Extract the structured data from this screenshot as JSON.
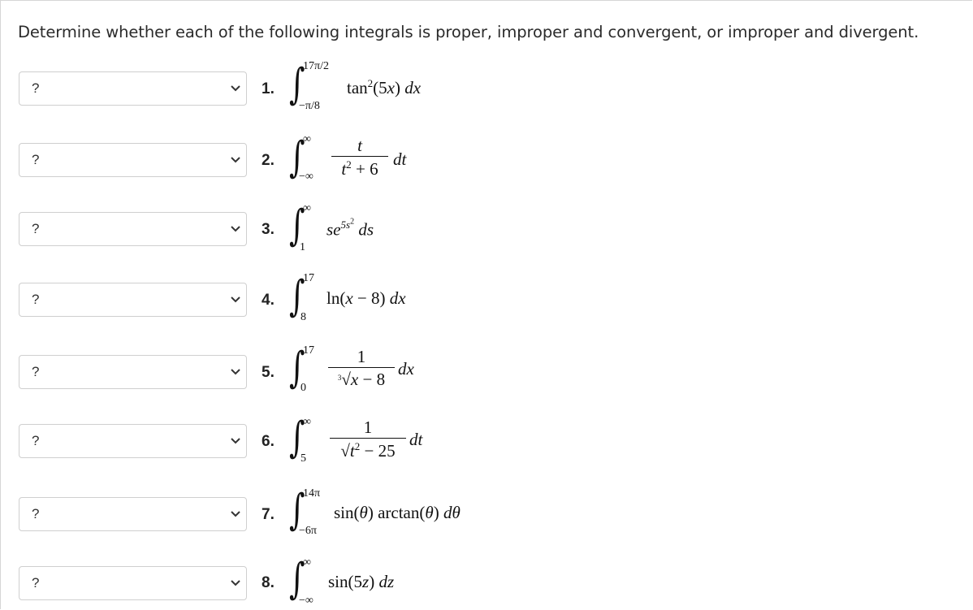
{
  "instructions": "Determine whether each of the following integrals is proper, improper and convergent, or improper and divergent.",
  "select_placeholder": "?",
  "items": [
    {
      "number": "1.",
      "lower": "−π/8",
      "upper": "17π/2",
      "integrand": "tan²(5x) dx"
    },
    {
      "number": "2.",
      "lower": "−∞",
      "upper": "∞",
      "numerator": "t",
      "denominator": "t² + 6",
      "differential": "dt"
    },
    {
      "number": "3.",
      "lower": "1",
      "upper": "∞",
      "integrand": "se^(5s²) ds"
    },
    {
      "number": "4.",
      "lower": "8",
      "upper": "17",
      "integrand": "ln(x − 8) dx"
    },
    {
      "number": "5.",
      "lower": "0",
      "upper": "17",
      "numerator": "1",
      "denominator": "∛(x − 8)",
      "differential": "dx"
    },
    {
      "number": "6.",
      "lower": "5",
      "upper": "∞",
      "numerator": "1",
      "denominator": "√(t² − 25)",
      "differential": "dt"
    },
    {
      "number": "7.",
      "lower": "−6π",
      "upper": "14π",
      "integrand": "sin(θ) arctan(θ) dθ"
    },
    {
      "number": "8.",
      "lower": "−∞",
      "upper": "∞",
      "integrand": "sin(5z) dz"
    }
  ]
}
